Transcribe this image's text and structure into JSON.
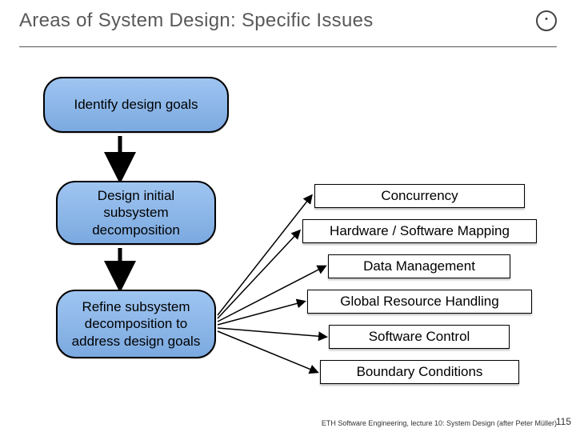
{
  "title": "Areas of System Design: Specific Issues",
  "logo_name": "eth-circle-logo-icon",
  "blue_boxes": {
    "b1": "Identify design goals",
    "b2": "Design initial subsystem decomposition",
    "b3": "Refine subsystem decomposition to address design goals"
  },
  "white_boxes": {
    "w1": "Concurrency",
    "w2": "Hardware / Software Mapping",
    "w3": "Data Management",
    "w4": "Global Resource Handling",
    "w5": "Software Control",
    "w6": "Boundary Conditions"
  },
  "footer": "ETH Software Engineering, lecture 10: System Design (after Peter Müller)",
  "page_number": "115"
}
